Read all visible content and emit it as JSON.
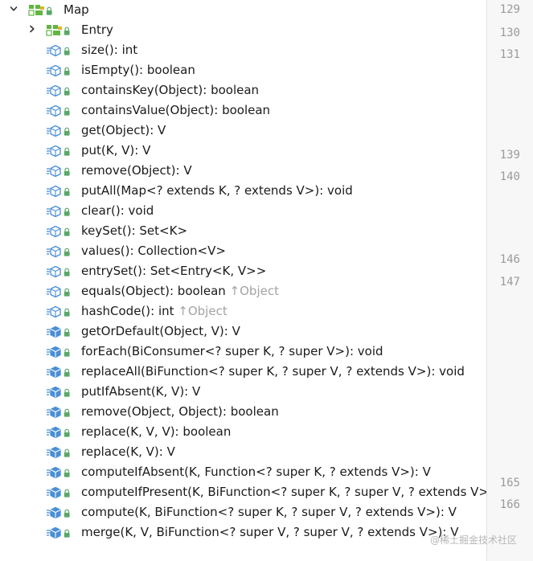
{
  "tree": {
    "root": {
      "label": "Map",
      "expanded": true,
      "icon": "interface-icon"
    },
    "entry": {
      "label": "Entry",
      "expanded": false,
      "icon": "interface-icon"
    },
    "members": [
      {
        "label": "size(): int",
        "icon": "abstract-method-icon"
      },
      {
        "label": "isEmpty(): boolean",
        "icon": "abstract-method-icon"
      },
      {
        "label": "containsKey(Object): boolean",
        "icon": "abstract-method-icon"
      },
      {
        "label": "containsValue(Object): boolean",
        "icon": "abstract-method-icon"
      },
      {
        "label": "get(Object): V",
        "icon": "abstract-method-icon"
      },
      {
        "label": "put(K, V): V",
        "icon": "abstract-method-icon"
      },
      {
        "label": "remove(Object): V",
        "icon": "abstract-method-icon"
      },
      {
        "label": "putAll(Map<? extends K, ? extends V>): void",
        "icon": "abstract-method-icon"
      },
      {
        "label": "clear(): void",
        "icon": "abstract-method-icon"
      },
      {
        "label": "keySet(): Set<K>",
        "icon": "abstract-method-icon"
      },
      {
        "label": "values(): Collection<V>",
        "icon": "abstract-method-icon"
      },
      {
        "label": "entrySet(): Set<Entry<K, V>>",
        "icon": "abstract-method-icon"
      },
      {
        "label": "equals(Object): boolean",
        "inherited": "↑Object",
        "icon": "abstract-method-icon"
      },
      {
        "label": "hashCode(): int",
        "inherited": "↑Object",
        "icon": "abstract-method-icon"
      },
      {
        "label": "getOrDefault(Object, V): V",
        "icon": "default-method-icon"
      },
      {
        "label": "forEach(BiConsumer<? super K, ? super V>): void",
        "icon": "default-method-icon"
      },
      {
        "label": "replaceAll(BiFunction<? super K, ? super V, ? extends V>): void",
        "icon": "default-method-icon"
      },
      {
        "label": "putIfAbsent(K, V): V",
        "icon": "default-method-icon"
      },
      {
        "label": "remove(Object, Object): boolean",
        "icon": "default-method-icon"
      },
      {
        "label": "replace(K, V, V): boolean",
        "icon": "default-method-icon"
      },
      {
        "label": "replace(K, V): V",
        "icon": "default-method-icon"
      },
      {
        "label": "computeIfAbsent(K, Function<? super K, ? extends V>): V",
        "icon": "default-method-icon"
      },
      {
        "label": "computeIfPresent(K, BiFunction<? super K, ? super V, ? extends V>): V",
        "icon": "default-method-icon"
      },
      {
        "label": "compute(K, BiFunction<? super K, ? super V, ? extends V>): V",
        "icon": "default-method-icon"
      },
      {
        "label": "merge(K, V, BiFunction<? super V, ? super V, ? extends V>): V",
        "icon": "default-method-icon"
      }
    ]
  },
  "gutter": {
    "line_numbers": [
      "129",
      "130",
      "131",
      "139",
      "140",
      "146",
      "147",
      "165",
      "166"
    ]
  },
  "watermark": "@稀土掘金技术社区",
  "colors": {
    "method_icon": "#4a8fd6",
    "interface_icon": "#62b543",
    "public_badge": "#59a869",
    "inherited_text": "#a3a3a3"
  }
}
